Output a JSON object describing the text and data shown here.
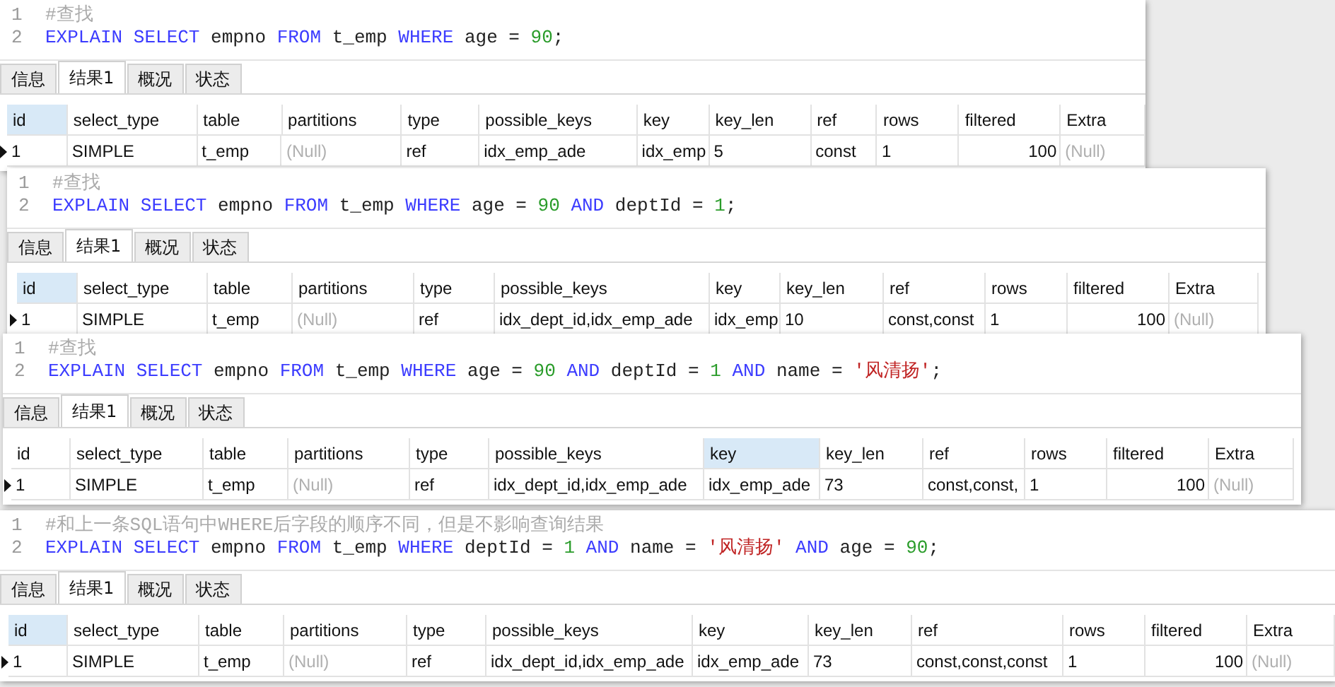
{
  "panels": [
    {
      "editor": {
        "lines": [
          {
            "number": "1",
            "tokens": [
              {
                "kind": "comment",
                "text": "#查找"
              }
            ]
          },
          {
            "number": "2",
            "tokens": [
              {
                "kind": "keyword",
                "text": "EXPLAIN SELECT"
              },
              {
                "kind": "plain",
                "text": " empno "
              },
              {
                "kind": "keyword",
                "text": "FROM"
              },
              {
                "kind": "plain",
                "text": " t_emp "
              },
              {
                "kind": "keyword",
                "text": "WHERE"
              },
              {
                "kind": "plain",
                "text": " age = "
              },
              {
                "kind": "number",
                "text": "90"
              },
              {
                "kind": "plain",
                "text": ";"
              }
            ]
          }
        ]
      },
      "tabs": [
        {
          "label": "信息",
          "selected": false
        },
        {
          "label": "结果1",
          "selected": true
        },
        {
          "label": "概况",
          "selected": false
        },
        {
          "label": "状态",
          "selected": false
        }
      ],
      "columns": [
        {
          "label": "id",
          "selected": true
        },
        {
          "label": "select_type",
          "selected": false
        },
        {
          "label": "table",
          "selected": false
        },
        {
          "label": "partitions",
          "selected": false
        },
        {
          "label": "type",
          "selected": false
        },
        {
          "label": "possible_keys",
          "selected": false
        },
        {
          "label": "key",
          "selected": false
        },
        {
          "label": "key_len",
          "selected": false
        },
        {
          "label": "ref",
          "selected": false
        },
        {
          "label": "rows",
          "selected": false
        },
        {
          "label": "filtered",
          "selected": false
        },
        {
          "label": "Extra",
          "selected": false
        }
      ],
      "rows": [
        {
          "current": true,
          "cells": [
            {
              "kind": "text",
              "text": "1"
            },
            {
              "kind": "text",
              "text": "SIMPLE"
            },
            {
              "kind": "text",
              "text": "t_emp"
            },
            {
              "kind": "null",
              "text": "(Null)"
            },
            {
              "kind": "text",
              "text": "ref"
            },
            {
              "kind": "text",
              "text": "idx_emp_ade"
            },
            {
              "kind": "text",
              "text": "idx_emp"
            },
            {
              "kind": "text",
              "text": "5"
            },
            {
              "kind": "text",
              "text": "const"
            },
            {
              "kind": "text",
              "text": "1"
            },
            {
              "kind": "number",
              "text": "100"
            },
            {
              "kind": "null",
              "text": "(Null)"
            }
          ]
        }
      ]
    },
    {
      "editor": {
        "lines": [
          {
            "number": "1",
            "tokens": [
              {
                "kind": "comment",
                "text": "#查找"
              }
            ]
          },
          {
            "number": "2",
            "tokens": [
              {
                "kind": "keyword",
                "text": "EXPLAIN SELECT"
              },
              {
                "kind": "plain",
                "text": " empno "
              },
              {
                "kind": "keyword",
                "text": "FROM"
              },
              {
                "kind": "plain",
                "text": " t_emp "
              },
              {
                "kind": "keyword",
                "text": "WHERE"
              },
              {
                "kind": "plain",
                "text": " age = "
              },
              {
                "kind": "number",
                "text": "90"
              },
              {
                "kind": "keyword",
                "text": " AND"
              },
              {
                "kind": "plain",
                "text": " deptId = "
              },
              {
                "kind": "number",
                "text": "1"
              },
              {
                "kind": "plain",
                "text": ";"
              }
            ]
          }
        ]
      },
      "tabs": [
        {
          "label": "信息",
          "selected": false
        },
        {
          "label": "结果1",
          "selected": true
        },
        {
          "label": "概况",
          "selected": false
        },
        {
          "label": "状态",
          "selected": false
        }
      ],
      "columns": [
        {
          "label": "id",
          "selected": true
        },
        {
          "label": "select_type",
          "selected": false
        },
        {
          "label": "table",
          "selected": false
        },
        {
          "label": "partitions",
          "selected": false
        },
        {
          "label": "type",
          "selected": false
        },
        {
          "label": "possible_keys",
          "selected": false
        },
        {
          "label": "key",
          "selected": false
        },
        {
          "label": "key_len",
          "selected": false
        },
        {
          "label": "ref",
          "selected": false
        },
        {
          "label": "rows",
          "selected": false
        },
        {
          "label": "filtered",
          "selected": false
        },
        {
          "label": "Extra",
          "selected": false
        }
      ],
      "rows": [
        {
          "current": true,
          "cells": [
            {
              "kind": "text",
              "text": "1"
            },
            {
              "kind": "text",
              "text": "SIMPLE"
            },
            {
              "kind": "text",
              "text": "t_emp"
            },
            {
              "kind": "null",
              "text": "(Null)"
            },
            {
              "kind": "text",
              "text": "ref"
            },
            {
              "kind": "text",
              "text": "idx_dept_id,idx_emp_ade"
            },
            {
              "kind": "text",
              "text": "idx_emp"
            },
            {
              "kind": "text",
              "text": "10"
            },
            {
              "kind": "text",
              "text": "const,const"
            },
            {
              "kind": "text",
              "text": "1"
            },
            {
              "kind": "number",
              "text": "100"
            },
            {
              "kind": "null",
              "text": "(Null)"
            }
          ]
        }
      ]
    },
    {
      "editor": {
        "lines": [
          {
            "number": "1",
            "tokens": [
              {
                "kind": "comment",
                "text": "#查找"
              }
            ]
          },
          {
            "number": "2",
            "tokens": [
              {
                "kind": "keyword",
                "text": "EXPLAIN SELECT"
              },
              {
                "kind": "plain",
                "text": " empno "
              },
              {
                "kind": "keyword",
                "text": "FROM"
              },
              {
                "kind": "plain",
                "text": " t_emp "
              },
              {
                "kind": "keyword",
                "text": "WHERE"
              },
              {
                "kind": "plain",
                "text": " age = "
              },
              {
                "kind": "number",
                "text": "90"
              },
              {
                "kind": "keyword",
                "text": " AND"
              },
              {
                "kind": "plain",
                "text": " deptId = "
              },
              {
                "kind": "number",
                "text": "1"
              },
              {
                "kind": "keyword",
                "text": " AND"
              },
              {
                "kind": "plain",
                "text": " name = "
              },
              {
                "kind": "string",
                "text": "'风清扬'"
              },
              {
                "kind": "plain",
                "text": ";"
              }
            ]
          }
        ]
      },
      "tabs": [
        {
          "label": "信息",
          "selected": false
        },
        {
          "label": "结果1",
          "selected": true
        },
        {
          "label": "概况",
          "selected": false
        },
        {
          "label": "状态",
          "selected": false
        }
      ],
      "columns": [
        {
          "label": "id",
          "selected": false
        },
        {
          "label": "select_type",
          "selected": false
        },
        {
          "label": "table",
          "selected": false
        },
        {
          "label": "partitions",
          "selected": false
        },
        {
          "label": "type",
          "selected": false
        },
        {
          "label": "possible_keys",
          "selected": false
        },
        {
          "label": "key",
          "selected": true
        },
        {
          "label": "key_len",
          "selected": false
        },
        {
          "label": "ref",
          "selected": false
        },
        {
          "label": "rows",
          "selected": false
        },
        {
          "label": "filtered",
          "selected": false
        },
        {
          "label": "Extra",
          "selected": false
        }
      ],
      "rows": [
        {
          "current": true,
          "cells": [
            {
              "kind": "text",
              "text": "1"
            },
            {
              "kind": "text",
              "text": "SIMPLE"
            },
            {
              "kind": "text",
              "text": "t_emp"
            },
            {
              "kind": "null",
              "text": "(Null)"
            },
            {
              "kind": "text",
              "text": "ref"
            },
            {
              "kind": "text",
              "text": "idx_dept_id,idx_emp_ade"
            },
            {
              "kind": "text",
              "text": "idx_emp_ade"
            },
            {
              "kind": "text",
              "text": "73"
            },
            {
              "kind": "text",
              "text": "const,const,"
            },
            {
              "kind": "text",
              "text": "1"
            },
            {
              "kind": "number",
              "text": "100"
            },
            {
              "kind": "null",
              "text": "(Null)"
            }
          ]
        }
      ]
    },
    {
      "editor": {
        "lines": [
          {
            "number": "1",
            "tokens": [
              {
                "kind": "comment",
                "text": "#和上一条SQL语句中WHERE后字段的顺序不同，但是不影响查询结果"
              }
            ]
          },
          {
            "number": "2",
            "tokens": [
              {
                "kind": "keyword",
                "text": "EXPLAIN SELECT"
              },
              {
                "kind": "plain",
                "text": " empno "
              },
              {
                "kind": "keyword",
                "text": "FROM"
              },
              {
                "kind": "plain",
                "text": " t_emp "
              },
              {
                "kind": "keyword",
                "text": "WHERE"
              },
              {
                "kind": "plain",
                "text": " deptId = "
              },
              {
                "kind": "number",
                "text": "1"
              },
              {
                "kind": "keyword",
                "text": " AND"
              },
              {
                "kind": "plain",
                "text": " name = "
              },
              {
                "kind": "string",
                "text": "'风清扬'"
              },
              {
                "kind": "keyword",
                "text": " AND"
              },
              {
                "kind": "plain",
                "text": " age = "
              },
              {
                "kind": "number",
                "text": "90"
              },
              {
                "kind": "plain",
                "text": ";"
              }
            ]
          }
        ]
      },
      "tabs": [
        {
          "label": "信息",
          "selected": false
        },
        {
          "label": "结果1",
          "selected": true
        },
        {
          "label": "概况",
          "selected": false
        },
        {
          "label": "状态",
          "selected": false
        }
      ],
      "columns": [
        {
          "label": "id",
          "selected": true
        },
        {
          "label": "select_type",
          "selected": false
        },
        {
          "label": "table",
          "selected": false
        },
        {
          "label": "partitions",
          "selected": false
        },
        {
          "label": "type",
          "selected": false
        },
        {
          "label": "possible_keys",
          "selected": false
        },
        {
          "label": "key",
          "selected": false
        },
        {
          "label": "key_len",
          "selected": false
        },
        {
          "label": "ref",
          "selected": false
        },
        {
          "label": "rows",
          "selected": false
        },
        {
          "label": "filtered",
          "selected": false
        },
        {
          "label": "Extra",
          "selected": false
        }
      ],
      "rows": [
        {
          "current": true,
          "cells": [
            {
              "kind": "text",
              "text": "1"
            },
            {
              "kind": "text",
              "text": "SIMPLE"
            },
            {
              "kind": "text",
              "text": "t_emp"
            },
            {
              "kind": "null",
              "text": "(Null)"
            },
            {
              "kind": "text",
              "text": "ref"
            },
            {
              "kind": "text",
              "text": "idx_dept_id,idx_emp_ade"
            },
            {
              "kind": "text",
              "text": "idx_emp_ade"
            },
            {
              "kind": "text",
              "text": "73"
            },
            {
              "kind": "text",
              "text": "const,const,const"
            },
            {
              "kind": "text",
              "text": "1"
            },
            {
              "kind": "number",
              "text": "100"
            },
            {
              "kind": "null",
              "text": "(Null)"
            }
          ]
        }
      ]
    }
  ]
}
